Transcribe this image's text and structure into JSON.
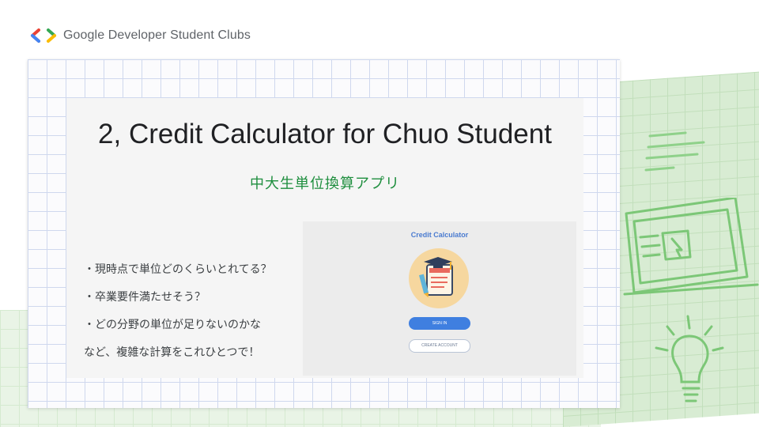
{
  "header": {
    "brand": "Google Developer Student Clubs",
    "logo_icon": "gdsc-chevrons-icon"
  },
  "slide": {
    "title": "2,  Credit Calculator for Chuo Student",
    "subtitle": "中大生単位換算アプリ",
    "bullets": [
      "・現時点で単位どのくらいとれてる？",
      "・卒業要件満たせそう？",
      "・どの分野の単位が足りないのかな",
      "など、複雑な計算をこれひとつで！"
    ]
  },
  "app_preview": {
    "title": "Credit Calculator",
    "signin_label": "SIGN IN",
    "create_label": "CREATE ACCOUNT",
    "illustration_icon": "graduation-cap-checklist-icon"
  },
  "colors": {
    "accent_green": "#1e8e3e",
    "app_blue": "#3f7fe0",
    "grid": "#cfd8ee",
    "logo_red": "#ea4335",
    "logo_blue": "#4285f4",
    "logo_green": "#34a853",
    "logo_yellow": "#fbbc04"
  }
}
